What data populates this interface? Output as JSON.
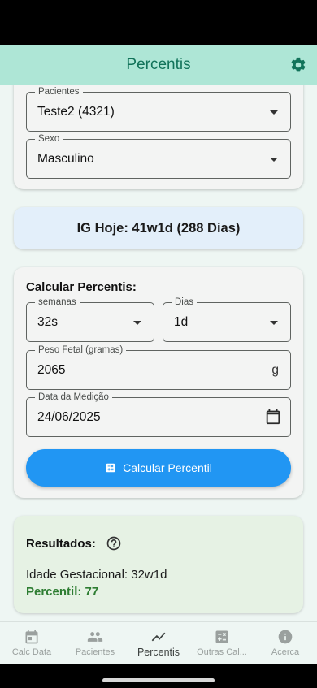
{
  "app_bar": {
    "title": "Percentis",
    "settings_icon": "gear-icon"
  },
  "patient_card": {
    "patients": {
      "label": "Pacientes",
      "value": "Teste2 (4321)"
    },
    "sex": {
      "label": "Sexo",
      "value": "Masculino"
    }
  },
  "ig_today": "IG Hoje: 41w1d (288 Dias)",
  "calc": {
    "title": "Calcular Percentis:",
    "weeks": {
      "label": "semanas",
      "value": "32s"
    },
    "days": {
      "label": "Dias",
      "value": "1d"
    },
    "weight": {
      "label": "Peso Fetal (gramas)",
      "value": "2065",
      "suffix": "g"
    },
    "date": {
      "label": "Data da Medição",
      "value": "24/06/2025"
    },
    "button": "Calcular Percentil"
  },
  "results": {
    "title": "Resultados:",
    "gestational_age": "Idade Gestacional: 32w1d",
    "percentile": "Percentil: 77"
  },
  "nav": [
    {
      "label": "Calc Data",
      "icon": "calendar-icon"
    },
    {
      "label": "Pacientes",
      "icon": "people-icon"
    },
    {
      "label": "Percentis",
      "icon": "trending-icon",
      "active": true
    },
    {
      "label": "Outras Cal...",
      "icon": "calculator-icon"
    },
    {
      "label": "Acerca",
      "icon": "info-icon"
    }
  ],
  "colors": {
    "app_bar": "#aee6d6",
    "title": "#12735a",
    "primary_button": "#2196f3",
    "ig_card": "#e3effa",
    "results_card": "#e6f2e4",
    "percentile_text": "#2e7d32"
  }
}
